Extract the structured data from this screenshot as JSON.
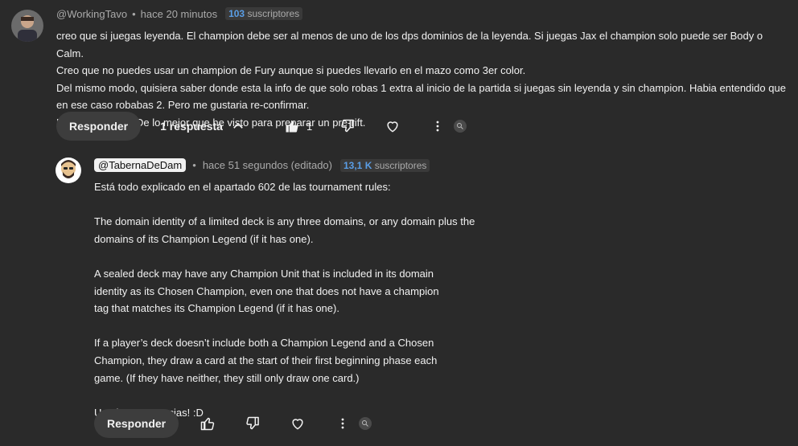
{
  "comment": {
    "handle": "@WorkingTavo",
    "time": "hace 20 minutos",
    "subs_count": "103",
    "subs_label": "suscriptores",
    "lines": [
      "creo que si juegas leyenda. El champion debe ser al menos de uno de los dps dominios de la leyenda. Si juegas Jax el champion solo puede ser Body o Calm.",
      "Creo que no puedes usar un champion de Fury aunque si puedes  llevarlo en el mazo como 3er color.",
      "Del mismo modo, quisiera saber donde esta la info de que solo robas 1 extra al inicio de la partida si juegas sin leyenda y sin champion. Habia entendido que",
      "en ese caso robabas 2. Pero me gustaria re-confirmar.",
      "Muy buen video! De lo mejor que he visto para preparar un pre-rift."
    ],
    "reply_label": "Responder",
    "replies_label": "1 respuesta",
    "like_count": "1"
  },
  "reply": {
    "handle": "@TabernaDeDam",
    "time": "hace 51 segundos (editado)",
    "subs_count": "13,1 K",
    "subs_label": "suscriptores",
    "paragraphs": [
      [
        "Está todo explicado en el apartado 602 de las tournament rules:"
      ],
      [
        "The domain identity of a limited deck is any three domains, or any domain plus the",
        "domains of its Champion Legend (if it has one)."
      ],
      [
        "A sealed deck may have any Champion Unit that is included in its domain",
        "identity as its Chosen Champion, even one that does not have a champion",
        "tag that matches its Champion Legend (if it has one)."
      ],
      [
        "If a player’s deck doesn’t include both a Champion Legend and a Chosen",
        "Champion, they draw a card at the start of their first beginning phase each",
        "game. (If they have neither, they still only draw one card.)"
      ],
      [
        "Un abrazo y gracias! :D"
      ]
    ],
    "reply_label": "Responder"
  },
  "icons": {
    "like": "thumb-up-icon",
    "dislike": "thumb-down-icon",
    "heart": "heart-icon",
    "more": "more-vert-icon",
    "badge": "search-badge-icon",
    "chevron": "chevron-up-icon"
  },
  "colors": {
    "background": "#2a2a2a",
    "subs_accent": "#5a9ee6",
    "button": "#3d3d3d"
  }
}
